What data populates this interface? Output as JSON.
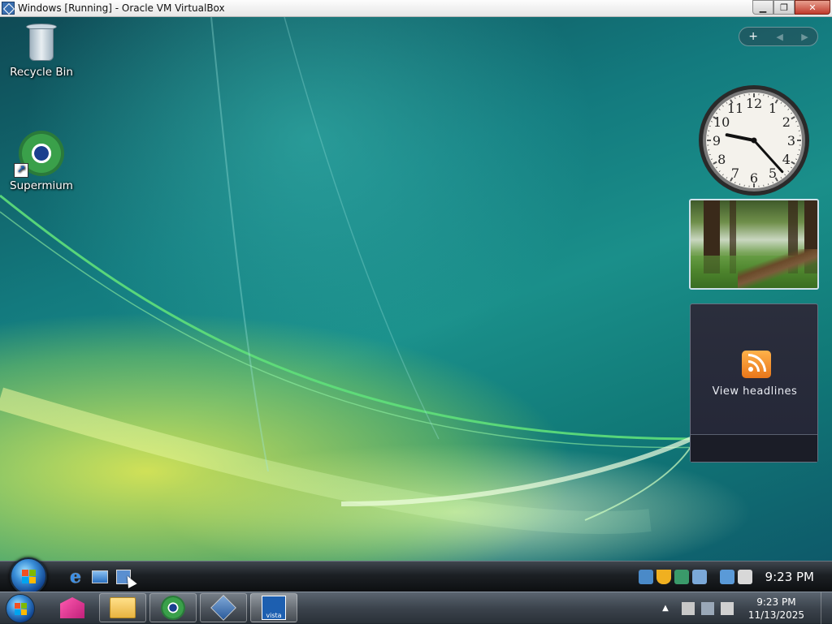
{
  "window": {
    "title": "Windows [Running] - Oracle VM VirtualBox",
    "minimize_glyph": "▁",
    "restore_glyph": "❐",
    "close_glyph": "✕"
  },
  "desktop": {
    "icons": [
      {
        "label": "Recycle Bin",
        "icon": "recycle-bin-icon"
      },
      {
        "label": "Supermium",
        "icon": "supermium-browser-icon"
      }
    ]
  },
  "gadgets": {
    "sidebar_controls": {
      "add": "+",
      "prev": "◀",
      "next": "▶"
    },
    "clock": {
      "hour": 9,
      "minute": 23,
      "numerals": [
        "12",
        "1",
        "2",
        "3",
        "4",
        "5",
        "6",
        "7",
        "8",
        "9",
        "10",
        "11"
      ]
    },
    "feed": {
      "label": "View headlines"
    }
  },
  "vm_taskbar": {
    "quick_launch": [
      "internet-explorer-icon",
      "show-desktop-icon",
      "virtualbox-icon"
    ],
    "tray_icons": [
      "network-icon",
      "security-shield-icon",
      "vm-display-icon",
      "sync-icon",
      "network-status-icon",
      "volume-icon"
    ],
    "time": "9:23 PM"
  },
  "host_taskbar": {
    "apps": [
      "pink-ribbon-app-icon",
      "file-explorer-icon",
      "supermium-browser-icon",
      "virtualbox-icon",
      "vista-vm-icon"
    ],
    "active_app": "vista-vm-icon",
    "vista_label": "vista",
    "tray_chevron": "▲",
    "time": "9:23 PM",
    "date": "11/13/2025"
  },
  "colors": {
    "vm_taskbar": "#1c2024",
    "host_taskbar": "#3c444d",
    "feed_bg": "#252838",
    "rss_orange": "#e8761a",
    "close_red": "#c0392b"
  }
}
